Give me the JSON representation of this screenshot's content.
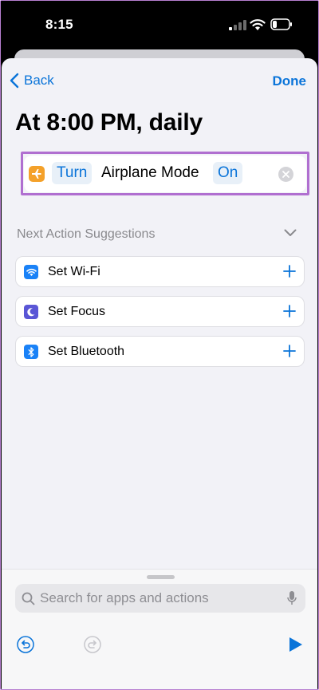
{
  "status_bar": {
    "time": "8:15"
  },
  "nav": {
    "back_label": "Back",
    "done_label": "Done"
  },
  "automation": {
    "title": "At 8:00 PM, daily"
  },
  "action": {
    "icon": "airplane-icon",
    "verb_token": "Turn",
    "name": "Airplane Mode",
    "state_token": "On",
    "accent_color": "#f4a12a"
  },
  "suggestions": {
    "header": "Next Action Suggestions",
    "items": [
      {
        "label": "Set Wi-Fi",
        "icon": "wifi-icon",
        "color": "#1a82f7"
      },
      {
        "label": "Set Focus",
        "icon": "moon-icon",
        "color": "#5a56d6"
      },
      {
        "label": "Set Bluetooth",
        "icon": "bluetooth-icon",
        "color": "#1a82f7"
      }
    ]
  },
  "search": {
    "placeholder": "Search for apps and actions"
  },
  "colors": {
    "accent": "#0a74d9",
    "highlight": "#b06fd0"
  }
}
